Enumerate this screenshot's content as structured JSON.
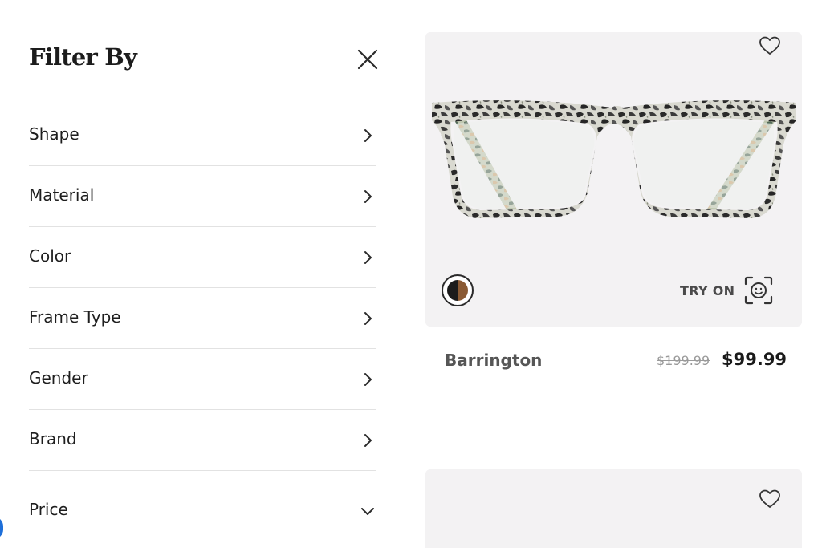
{
  "filter": {
    "title": "Filter By",
    "close_icon": "close-icon",
    "items": [
      {
        "label": "Shape",
        "icon": "chevron-right-icon"
      },
      {
        "label": "Material",
        "icon": "chevron-right-icon"
      },
      {
        "label": "Color",
        "icon": "chevron-right-icon"
      },
      {
        "label": "Frame Type",
        "icon": "chevron-right-icon"
      },
      {
        "label": "Gender",
        "icon": "chevron-right-icon"
      },
      {
        "label": "Brand",
        "icon": "chevron-right-icon"
      },
      {
        "label": "Price",
        "icon": "chevron-down-icon"
      }
    ]
  },
  "products": [
    {
      "name": "Barrington",
      "original_price": "$199.99",
      "sale_price": "$99.99",
      "try_on_label": "TRY ON",
      "favorite_icon": "heart-outline-icon",
      "try_on_icon": "face-scan-icon",
      "swatch_colors": [
        "#1b1b1b",
        "#8a5a34"
      ]
    },
    {
      "favorite_icon": "heart-outline-icon"
    }
  ],
  "colors": {
    "card_background": "#f3f2f3",
    "divider": "#e2e2e2",
    "text_dark": "#1e1e1e",
    "text_muted": "#9a9a9a"
  }
}
